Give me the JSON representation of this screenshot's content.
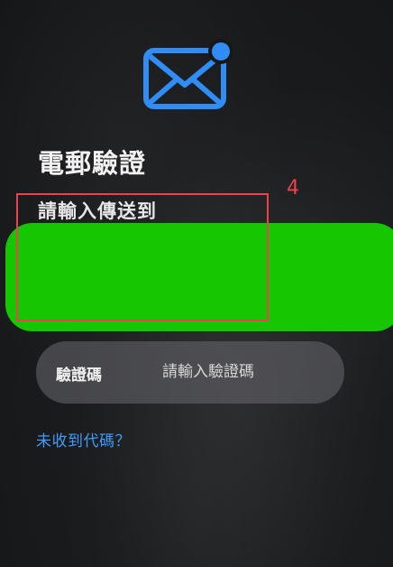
{
  "header": {
    "icon": "mail-notification-icon",
    "title": "電郵驗證"
  },
  "instruction": {
    "text": "請輸入傳送到"
  },
  "annotation": {
    "label": "4",
    "color": "#e8434f"
  },
  "redaction": {
    "color": "#15c600"
  },
  "code_field": {
    "label": "驗證碼",
    "placeholder": "請輸入驗證碼"
  },
  "resend": {
    "label": "未收到代碼？"
  },
  "colors": {
    "accent": "#2f8df5",
    "link": "#3e9cff"
  }
}
